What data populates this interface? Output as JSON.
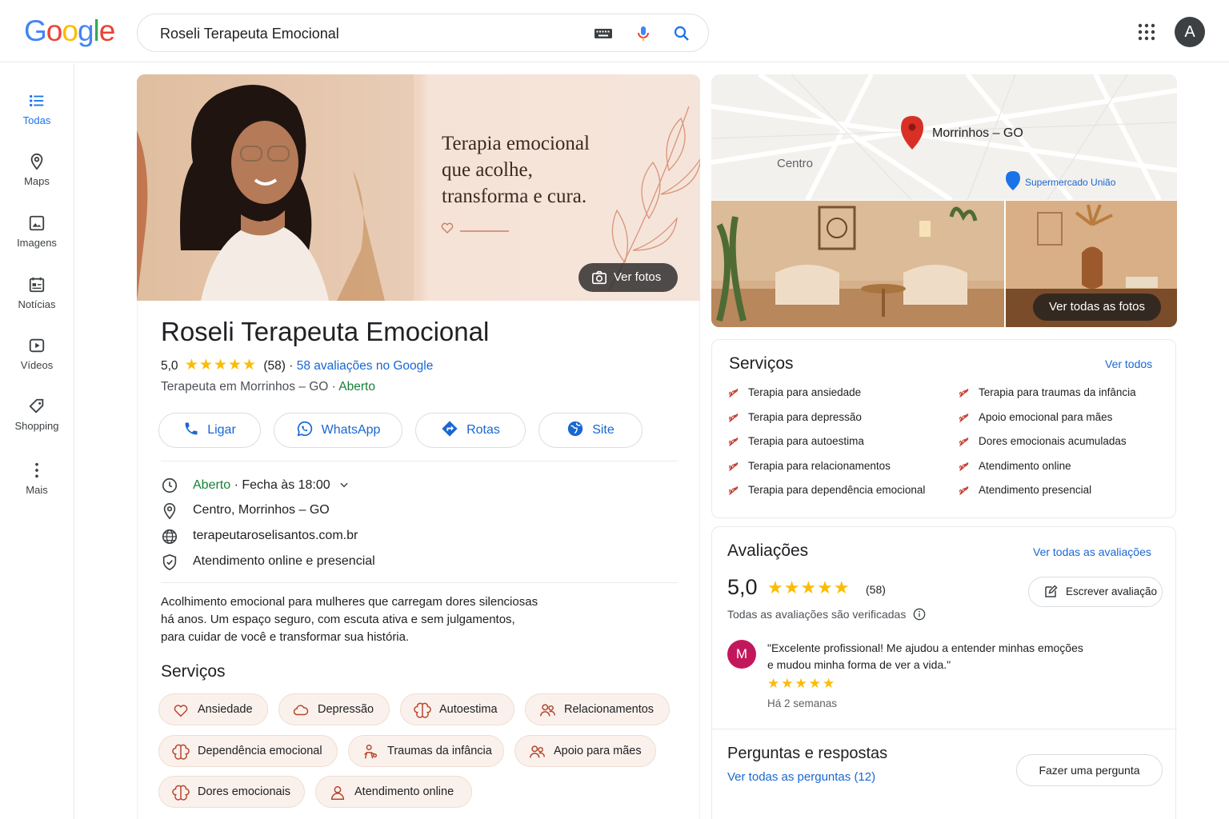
{
  "header": {
    "search_query": "Roseli Terapeuta Emocional",
    "avatar_letter": "A",
    "logo_letters": [
      "G",
      "o",
      "o",
      "g",
      "l",
      "e"
    ],
    "logo_colors": [
      "#4285F4",
      "#EA4335",
      "#FBBC05",
      "#4285F4",
      "#34A853",
      "#EA4335"
    ]
  },
  "nav": {
    "items": [
      {
        "label": "Todas",
        "icon": "list-icon",
        "active": true
      },
      {
        "label": "Maps",
        "icon": "map-pin-icon"
      },
      {
        "label": "Imagens",
        "icon": "image-icon"
      },
      {
        "label": "Notícias",
        "icon": "news-icon"
      },
      {
        "label": "Vídeos",
        "icon": "video-icon"
      },
      {
        "label": "Shopping",
        "icon": "tag-icon"
      },
      {
        "label": "Mais",
        "icon": "more-vert-icon"
      }
    ]
  },
  "hero": {
    "quote_lines": [
      "Terapia emocional",
      "que acolhe,",
      "transforma e cura."
    ],
    "photos_button": "Ver fotos"
  },
  "business": {
    "name": "Roseli Terapeuta Emocional",
    "rating": "5,0",
    "stars": "★★★★★",
    "review_count": "(58)",
    "separator": "·",
    "reviews_link": "58 avaliações no Google",
    "category": "Terapeuta em Morrinhos – GO",
    "open_status": "Aberto",
    "actions": [
      {
        "label": "Ligar",
        "icon": "phone-icon"
      },
      {
        "label": "WhatsApp",
        "icon": "whatsapp-icon"
      },
      {
        "label": "Rotas",
        "icon": "directions-icon"
      },
      {
        "label": "Site",
        "icon": "globe-icon"
      }
    ],
    "hours_status": "Aberto",
    "hours_close": "Fecha às 18:00",
    "address": "Centro, Morrinhos – GO",
    "website": "terapeutaroselisantos.com.br",
    "service_mode": "Atendimento online e presencial",
    "description_lines": [
      "Acolhimento emocional para mulheres que carregam dores silenciosas",
      "há anos. Um espaço seguro, com escuta ativa e sem julgamentos,",
      "para cuidar de você e transformar sua história."
    ],
    "services_title": "Serviços",
    "chips": [
      {
        "label": "Ansiedade",
        "icon": "heart-icon"
      },
      {
        "label": "Depressão",
        "icon": "cloud-icon"
      },
      {
        "label": "Autoestima",
        "icon": "brain-icon"
      },
      {
        "label": "Relacionamentos",
        "icon": "people-icon"
      },
      {
        "label": "Dependência emocional",
        "icon": "brain-icon"
      },
      {
        "label": "Traumas da infância",
        "icon": "child-icon"
      },
      {
        "label": "Apoio para mães",
        "icon": "people-icon"
      },
      {
        "label": "Dores emocionais",
        "icon": "brain-icon"
      },
      {
        "label": "Atendimento online",
        "icon": "person-icon"
      }
    ]
  },
  "map": {
    "city": "Morrinhos – GO",
    "district": "Centro",
    "poi": "Supermercado União"
  },
  "gallery": {
    "all_photos_button": "Ver todas as fotos"
  },
  "services_card": {
    "title": "Serviços",
    "see_all": "Ver todos",
    "left_items": [
      "Terapia para ansiedade",
      "Terapia para depressão",
      "Terapia para autoestima",
      "Terapia para relacionamentos",
      "Terapia para dependência emocional"
    ],
    "right_items": [
      "Terapia para traumas da infância",
      "Apoio emocional para mães",
      "Dores emocionais acumuladas",
      "Atendimento online",
      "Atendimento presencial"
    ]
  },
  "reviews_card": {
    "title": "Avaliações",
    "see_all": "Ver todas as avaliações",
    "rating": "5,0",
    "stars": "★★★★★",
    "count": "(58)",
    "write_button": "Escrever avaliação",
    "verified_note": "Todas as avaliações são verificadas",
    "review": {
      "avatar_letter": "M",
      "text_lines": [
        "\"Excelente profissional! Me ajudou a entender minhas emoções",
        "e mudou minha forma de ver a vida.\""
      ],
      "stars": "★★★★★",
      "time": "Há 2 semanas"
    },
    "qa_title": "Perguntas e respostas",
    "qa_link": "Ver todas as perguntas (12)",
    "ask_button": "Fazer uma pergunta"
  }
}
